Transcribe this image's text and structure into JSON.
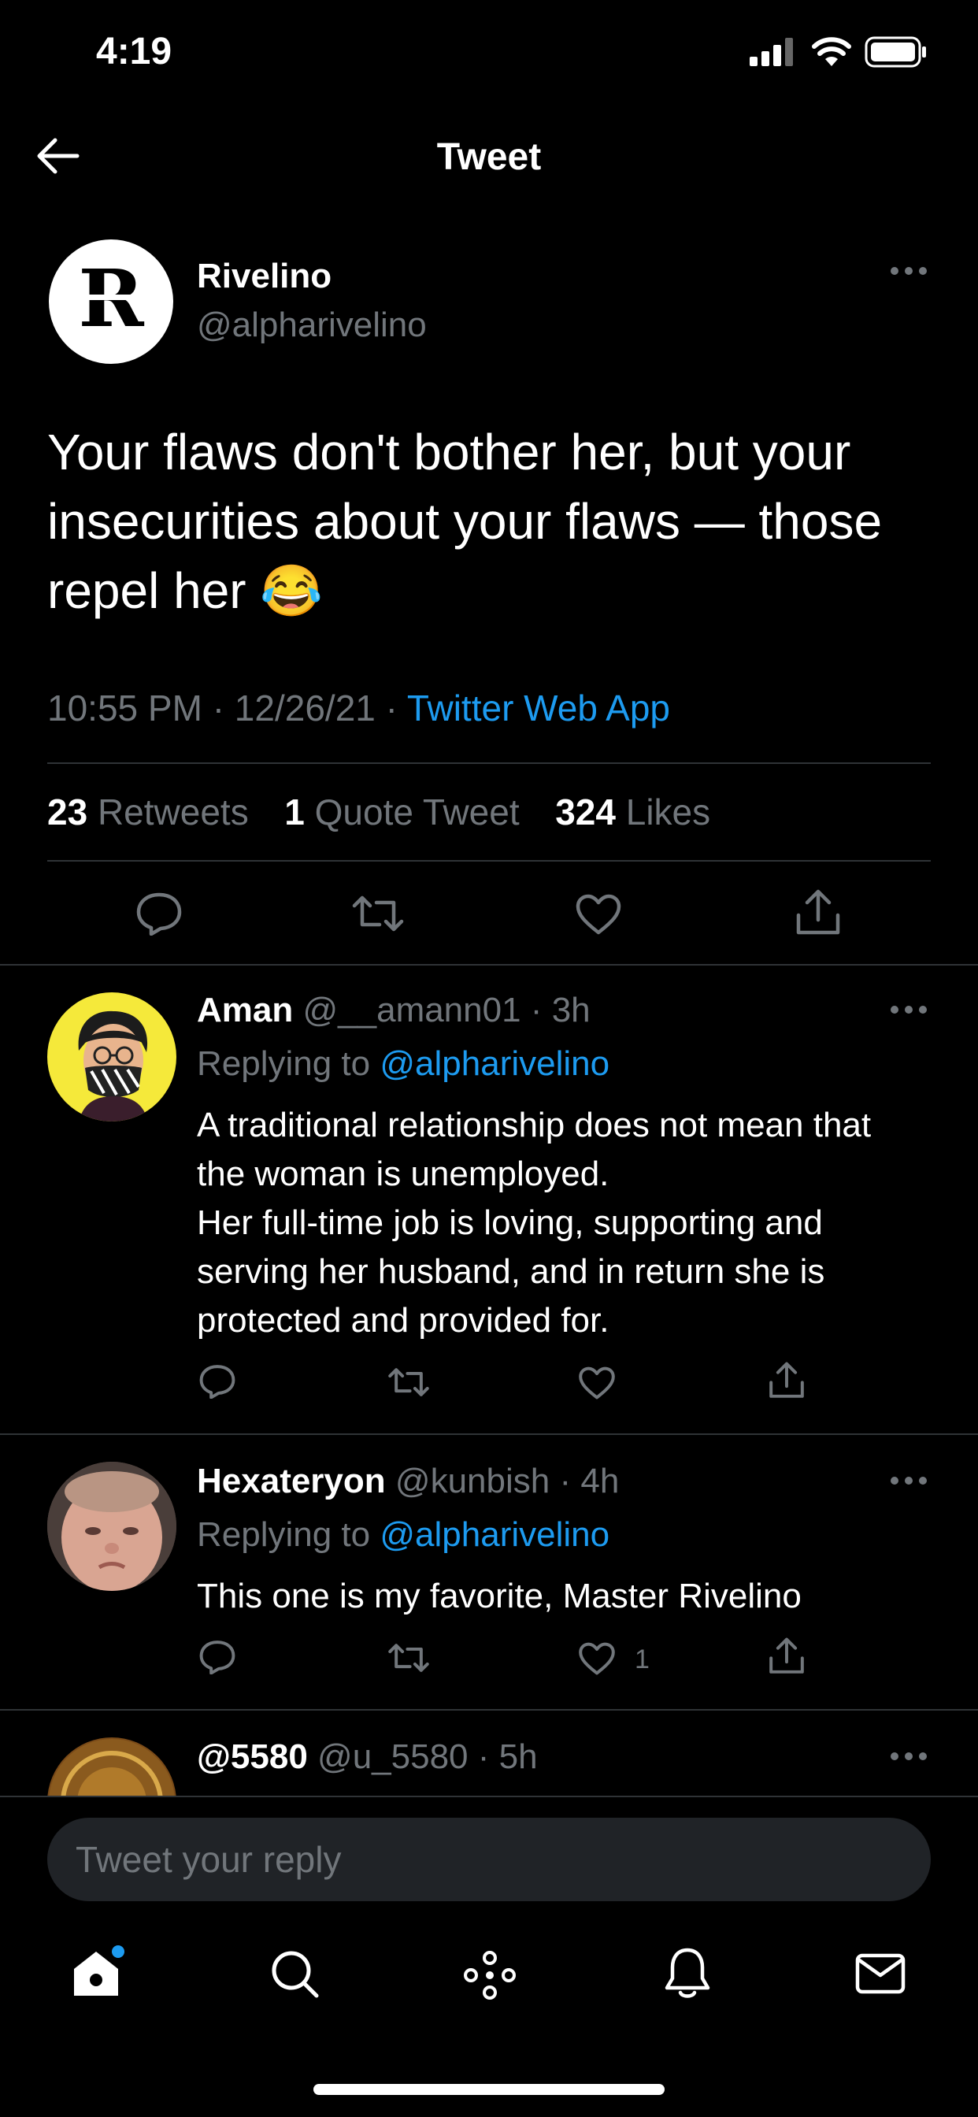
{
  "status_bar": {
    "time": "4:19"
  },
  "header": {
    "title": "Tweet"
  },
  "tweet": {
    "author_name": "Rivelino",
    "author_handle": "@alpharivelino",
    "avatar_letter": "R",
    "text": "Your flaws don't bother her, but your insecurities about your flaws — those repel her 😂",
    "time": "10:55 PM",
    "date": "12/26/21",
    "source": "Twitter Web App",
    "stats": {
      "retweets_count": "23",
      "retweets_label": "Retweets",
      "quotes_count": "1",
      "quotes_label": "Quote Tweet",
      "likes_count": "324",
      "likes_label": "Likes"
    }
  },
  "replies": [
    {
      "name": "Aman",
      "handle": "@__amann01",
      "age": "3h",
      "replying_label": "Replying to",
      "replying_to": "@alpharivelino",
      "text_lines": [
        "A traditional relationship does not mean that the woman is unemployed.",
        "Her full-time job is loving, supporting and serving her husband, and in return she is protected and provided for."
      ]
    },
    {
      "name": "Hexateryon",
      "handle": "@kunbish",
      "age": "4h",
      "replying_label": "Replying to",
      "replying_to": "@alpharivelino",
      "text_lines": [
        "This one is my favorite, Master Rivelino"
      ],
      "like_count": "1"
    },
    {
      "name": "@5580",
      "handle": "@u_5580",
      "age": "5h"
    }
  ],
  "composer": {
    "placeholder": "Tweet your reply"
  },
  "icons": {
    "back": "arrow-left-icon",
    "more": "more-horizontal-icon",
    "reply": "reply-icon",
    "retweet": "retweet-icon",
    "like": "heart-icon",
    "share": "share-icon",
    "home": "home-icon",
    "search": "search-icon",
    "spaces": "spaces-icon",
    "notifications": "bell-icon",
    "messages": "mail-icon"
  },
  "colors": {
    "background": "#000000",
    "accent": "#1d9bf0",
    "secondary_text": "#71767b"
  }
}
